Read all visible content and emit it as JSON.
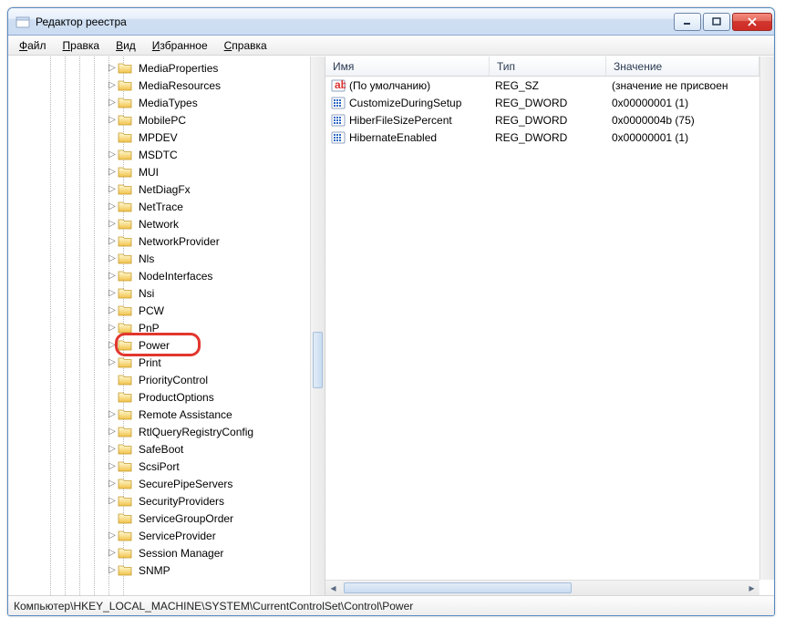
{
  "window": {
    "title": "Редактор реестра"
  },
  "menu": {
    "file": "Файл",
    "edit": "Правка",
    "view": "Вид",
    "favorites": "Избранное",
    "help": "Справка"
  },
  "tree": {
    "items": [
      {
        "label": "MediaProperties",
        "caret": true
      },
      {
        "label": "MediaResources",
        "caret": true
      },
      {
        "label": "MediaTypes",
        "caret": true
      },
      {
        "label": "MobilePC",
        "caret": true
      },
      {
        "label": "MPDEV",
        "caret": false
      },
      {
        "label": "MSDTC",
        "caret": true
      },
      {
        "label": "MUI",
        "caret": true
      },
      {
        "label": "NetDiagFx",
        "caret": true
      },
      {
        "label": "NetTrace",
        "caret": true
      },
      {
        "label": "Network",
        "caret": true
      },
      {
        "label": "NetworkProvider",
        "caret": true
      },
      {
        "label": "Nls",
        "caret": true
      },
      {
        "label": "NodeInterfaces",
        "caret": true
      },
      {
        "label": "Nsi",
        "caret": true
      },
      {
        "label": "PCW",
        "caret": true
      },
      {
        "label": "PnP",
        "caret": true
      },
      {
        "label": "Power",
        "caret": true,
        "highlight": true
      },
      {
        "label": "Print",
        "caret": true
      },
      {
        "label": "PriorityControl",
        "caret": false
      },
      {
        "label": "ProductOptions",
        "caret": false
      },
      {
        "label": "Remote Assistance",
        "caret": true
      },
      {
        "label": "RtlQueryRegistryConfig",
        "caret": true
      },
      {
        "label": "SafeBoot",
        "caret": true
      },
      {
        "label": "ScsiPort",
        "caret": true
      },
      {
        "label": "SecurePipeServers",
        "caret": true
      },
      {
        "label": "SecurityProviders",
        "caret": true
      },
      {
        "label": "ServiceGroupOrder",
        "caret": false
      },
      {
        "label": "ServiceProvider",
        "caret": true
      },
      {
        "label": "Session Manager",
        "caret": true
      },
      {
        "label": "SNMP",
        "caret": true
      }
    ]
  },
  "list": {
    "columns": {
      "name": "Имя",
      "type": "Тип",
      "value": "Значение"
    },
    "rows": [
      {
        "icon": "string",
        "name": "(По умолчанию)",
        "type": "REG_SZ",
        "value": "(значение не присвоен"
      },
      {
        "icon": "dword",
        "name": "CustomizeDuringSetup",
        "type": "REG_DWORD",
        "value": "0x00000001 (1)"
      },
      {
        "icon": "dword",
        "name": "HiberFileSizePercent",
        "type": "REG_DWORD",
        "value": "0x0000004b (75)"
      },
      {
        "icon": "dword",
        "name": "HibernateEnabled",
        "type": "REG_DWORD",
        "value": "0x00000001 (1)"
      }
    ]
  },
  "status": {
    "path": "Компьютер\\HKEY_LOCAL_MACHINE\\SYSTEM\\CurrentControlSet\\Control\\Power"
  }
}
